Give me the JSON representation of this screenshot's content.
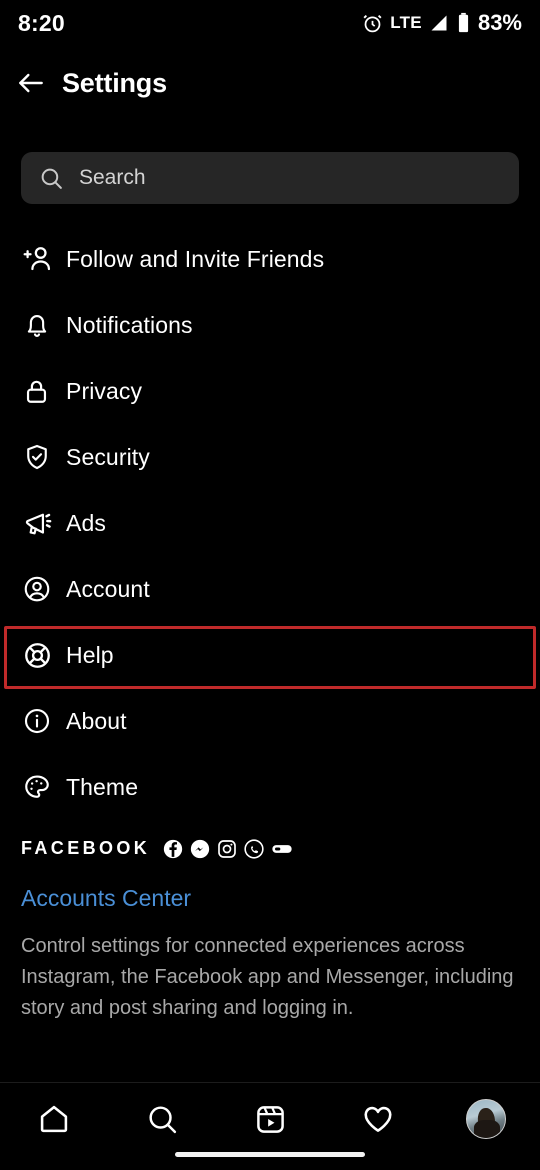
{
  "status_bar": {
    "time": "8:20",
    "alarm_icon": "alarm-icon",
    "network": "LTE",
    "signal_icon": "signal-icon",
    "battery_icon": "battery-icon",
    "battery_level": "83%"
  },
  "header": {
    "back_icon": "back-arrow-icon",
    "title": "Settings"
  },
  "search": {
    "icon": "search-icon",
    "placeholder": "Search",
    "value": ""
  },
  "menu": {
    "items": [
      {
        "label": "Follow and Invite Friends",
        "icon": "add-person-icon",
        "highlighted": false
      },
      {
        "label": "Notifications",
        "icon": "bell-icon",
        "highlighted": false
      },
      {
        "label": "Privacy",
        "icon": "lock-icon",
        "highlighted": false
      },
      {
        "label": "Security",
        "icon": "shield-check-icon",
        "highlighted": false
      },
      {
        "label": "Ads",
        "icon": "megaphone-icon",
        "highlighted": false
      },
      {
        "label": "Account",
        "icon": "user-circle-icon",
        "highlighted": false
      },
      {
        "label": "Help",
        "icon": "life-ring-icon",
        "highlighted": true
      },
      {
        "label": "About",
        "icon": "info-circle-icon",
        "highlighted": false
      },
      {
        "label": "Theme",
        "icon": "palette-icon",
        "highlighted": false
      }
    ],
    "highlight_color": "#c02a2a"
  },
  "facebook_section": {
    "brand_word": "FACEBOOK",
    "brand_icons": [
      "facebook-icon",
      "messenger-icon",
      "instagram-icon",
      "whatsapp-icon",
      "portal-icon"
    ],
    "accounts_center_link": "Accounts Center",
    "accounts_center_color": "#4a8fd6",
    "description": "Control settings for connected experiences across Instagram, the Facebook app and Messenger, including story and post sharing and logging in."
  },
  "bottom_nav": {
    "items": [
      {
        "name": "home",
        "icon": "home-icon"
      },
      {
        "name": "search",
        "icon": "search-icon"
      },
      {
        "name": "reels",
        "icon": "reels-icon"
      },
      {
        "name": "activity",
        "icon": "heart-icon"
      },
      {
        "name": "profile",
        "icon": "avatar-icon"
      }
    ]
  },
  "theme": {
    "background": "#000000",
    "text": "#ffffff",
    "muted_text": "#a8a8a8",
    "search_bg": "#262626"
  }
}
